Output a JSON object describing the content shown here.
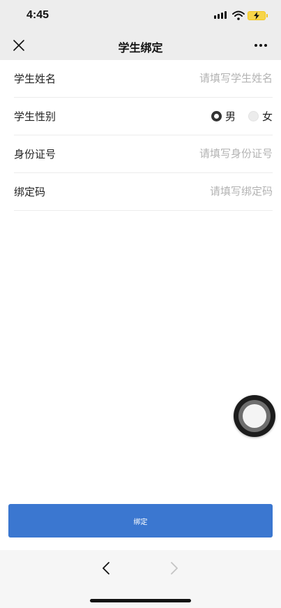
{
  "status_bar": {
    "time": "4:45",
    "icons": [
      "signal-icon",
      "wifi-icon",
      "battery-charging-icon"
    ]
  },
  "nav": {
    "title": "学生绑定",
    "left_icon": "close-icon",
    "right_icon": "more-icon"
  },
  "form": {
    "name": {
      "label": "学生姓名",
      "value": "",
      "placeholder": "请填写学生姓名"
    },
    "gender": {
      "label": "学生性别",
      "options": [
        {
          "label": "男",
          "selected": true
        },
        {
          "label": "女",
          "selected": false
        }
      ]
    },
    "id_number": {
      "label": "身份证号",
      "value": "",
      "placeholder": "请填写身份证号"
    },
    "bind_code": {
      "label": "绑定码",
      "value": "",
      "placeholder": "请填写绑定码"
    }
  },
  "actions": {
    "bind_label": "绑定"
  },
  "bottom_bar": {
    "icons": [
      "back-icon",
      "forward-icon"
    ]
  },
  "colors": {
    "primary_button": "#3b77d0",
    "bar_background": "#ededed",
    "placeholder": "#b3b3b3"
  }
}
